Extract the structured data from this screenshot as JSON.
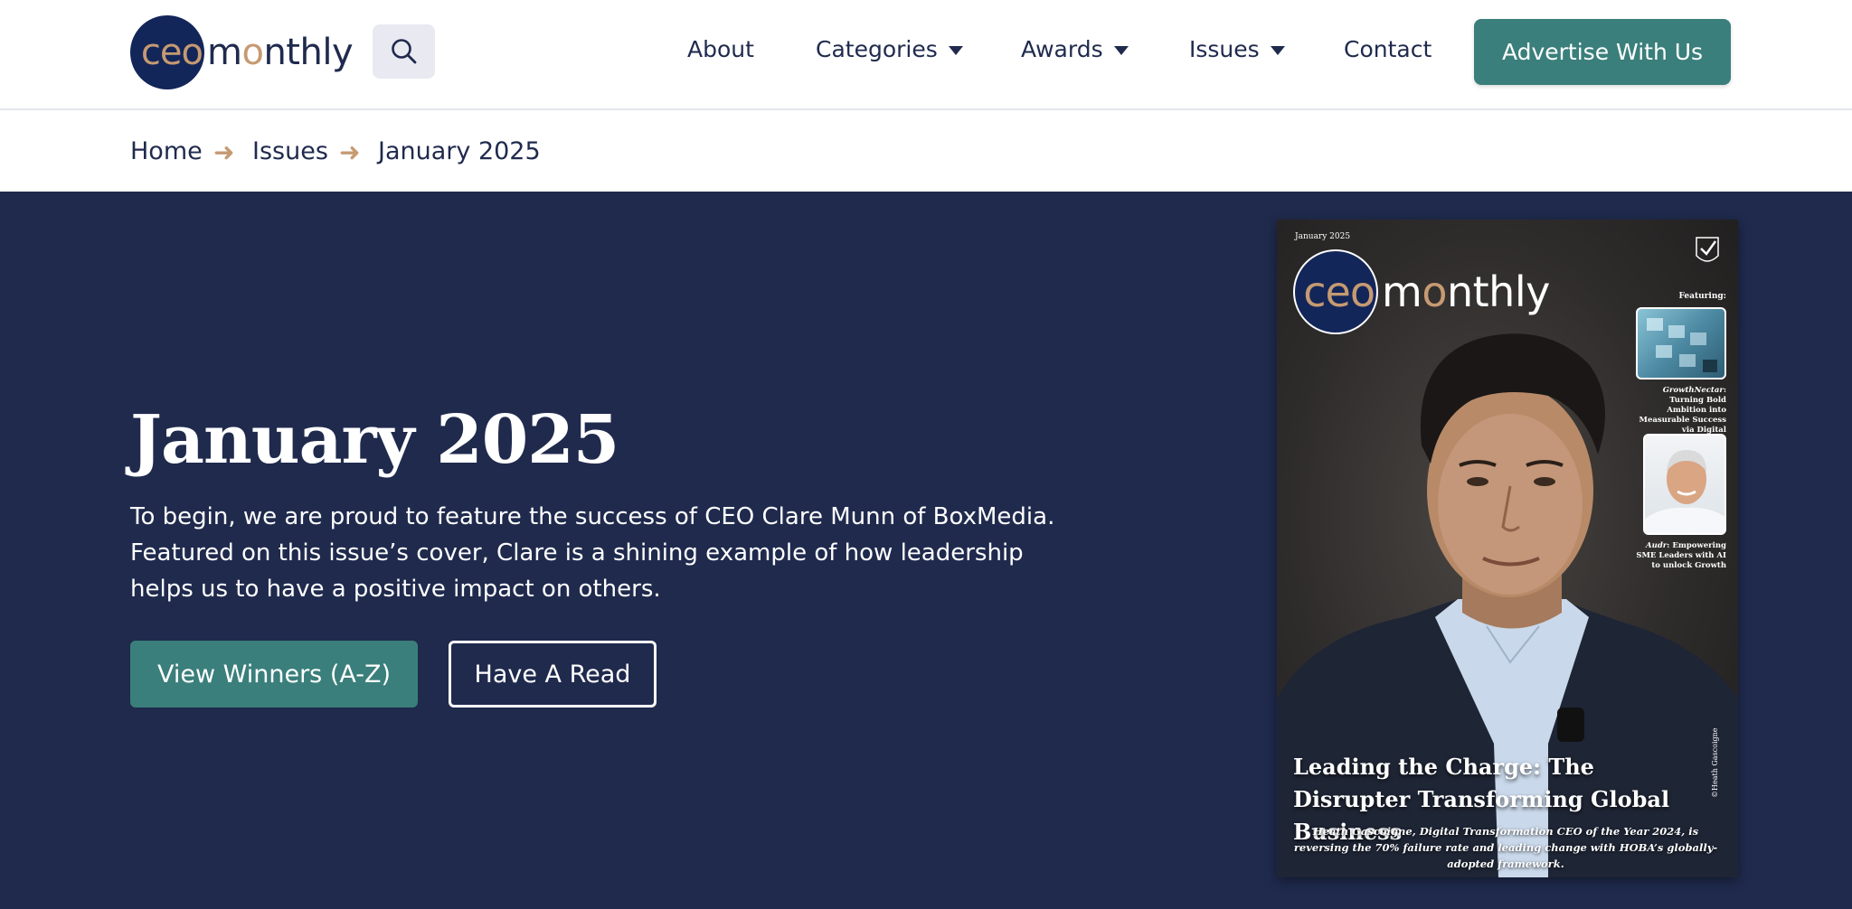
{
  "header": {
    "logo_ceo": "ceo",
    "logo_monthly_m": "m",
    "logo_monthly_o": "o",
    "logo_monthly_rest": "nthly",
    "nav": [
      {
        "label": "About"
      },
      {
        "label": "Categories"
      },
      {
        "label": "Awards"
      },
      {
        "label": "Issues"
      },
      {
        "label": "Contact"
      }
    ],
    "cta_label": "Advertise With Us"
  },
  "breadcrumb": {
    "items": [
      "Home",
      "Issues",
      "January 2025"
    ],
    "separator": "➜"
  },
  "hero": {
    "title": "January 2025",
    "description": "To begin, we are proud to feature the success of CEO Clare Munn of BoxMedia. Featured on this issue’s cover, Clare is a shining example of how leadership helps us to have a positive impact on others.",
    "primary_button": "View Winners (A-Z)",
    "secondary_button": "Have A Read"
  },
  "cover": {
    "date": "January 2025",
    "logo_ceo": "ceo",
    "logo_m": "m",
    "logo_o": "o",
    "logo_rest": "nthly",
    "featuring_label": "Featuring:",
    "feature1_brand": "GrowthNectar",
    "feature1_text": ": Turning Bold Ambition into Measurable Success via Digital Transformation",
    "feature2_brand": "Audr",
    "feature2_text": ": Empowering SME Leaders with AI to unlock Growth",
    "headline": "Leading the Charge: The Disrupter Transforming Global Business",
    "subheadline": "Heath Gascoigne, Digital Transformation CEO of the Year 2024, is reversing the 70% failure rate and leading change with HOBA’s globally-adopted framework.",
    "credit": "©Heath Gascoigne"
  },
  "colors": {
    "navy": "#1f2a4d",
    "teal": "#3a7f7b",
    "accent": "#c69a72",
    "white": "#ffffff"
  },
  "icons": {
    "search": "search-icon",
    "caret": "caret-down-icon",
    "arrow": "arrow-right-icon"
  }
}
